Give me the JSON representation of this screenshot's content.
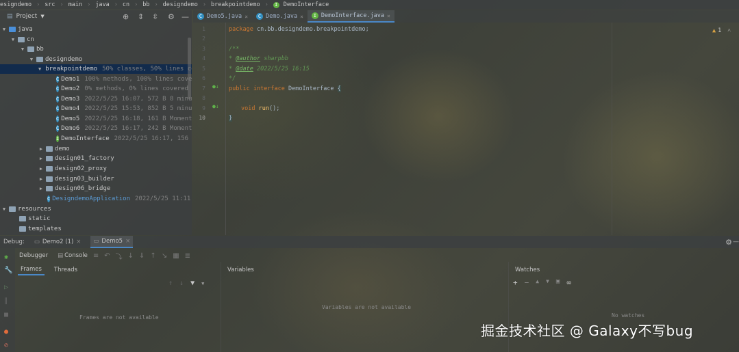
{
  "breadcrumb": [
    "esigndemo",
    "src",
    "main",
    "java",
    "cn",
    "bb",
    "designdemo",
    "breakpointdemo",
    "DemoInterface"
  ],
  "project_panel": {
    "title": "Project",
    "tree": [
      {
        "label": "java",
        "meta": ""
      },
      {
        "label": "cn",
        "meta": ""
      },
      {
        "label": "bb",
        "meta": ""
      },
      {
        "label": "designdemo",
        "meta": ""
      },
      {
        "label": "breakpointdemo",
        "meta": "50% classes, 50% lines cove"
      },
      {
        "label": "Demo1",
        "meta": "100% methods, 100% lines covered"
      },
      {
        "label": "Demo2",
        "meta": "0% methods, 0% lines covered  202"
      },
      {
        "label": "Demo3",
        "meta": "2022/5/25 16:07, 572 B 8 minute"
      },
      {
        "label": "Demo4",
        "meta": "2022/5/25 15:53, 852 B 5 minutes"
      },
      {
        "label": "Demo5",
        "meta": "2022/5/25 16:18, 161 B Moments ag"
      },
      {
        "label": "Demo6",
        "meta": "2022/5/25 16:17, 242 B Moments ag"
      },
      {
        "label": "DemoInterface",
        "meta": "2022/5/25 16:17, 156 B Mo"
      },
      {
        "label": "demo",
        "meta": ""
      },
      {
        "label": "design01_factory",
        "meta": ""
      },
      {
        "label": "design02_proxy",
        "meta": ""
      },
      {
        "label": "design03_builder",
        "meta": ""
      },
      {
        "label": "design06_bridge",
        "meta": ""
      },
      {
        "label": "DesigndemoApplication",
        "meta": "2022/5/25 11:11, 429"
      },
      {
        "label": "resources",
        "meta": ""
      },
      {
        "label": "static",
        "meta": ""
      },
      {
        "label": "templates",
        "meta": ""
      }
    ]
  },
  "editor": {
    "tabs": [
      "Demo5.java",
      "Demo.java",
      "DemoInterface.java"
    ],
    "line_numbers": [
      "1",
      "2",
      "3",
      "4",
      "5",
      "6",
      "7",
      "8",
      "9",
      "10"
    ],
    "code": {
      "l1_kw": "package",
      "l1_rest": " cn.bb.designdemo.breakpointdemo;",
      "l3": "/**",
      "l4_star": " * ",
      "l4_tag": "@author",
      "l4_val": " sharpbb",
      "l5_star": " * ",
      "l5_tag": "@date",
      "l5_val": " 2022/5/25 16:15",
      "l6": " */",
      "l7_kw1": "public",
      "l7_kw2": " interface",
      "l7_name": " DemoInterface ",
      "l7_brace": "{",
      "l9_kw": "void",
      "l9_fn": " run",
      "l9_rest": "();",
      "l10": "}"
    },
    "warnings": "1"
  },
  "debug": {
    "label": "Debug:",
    "sessions": [
      "Demo2 (1)",
      "Demo5"
    ],
    "tabs": [
      "Debugger",
      "Console"
    ],
    "frames_tabs": [
      "Frames",
      "Threads"
    ],
    "variables_title": "Variables",
    "watches_title": "Watches",
    "frames_empty": "Frames are not available",
    "variables_empty": "Variables are not available",
    "watches_empty": "No watches"
  },
  "watermark": "掘金技术社区 @ Galaxy不写bug"
}
